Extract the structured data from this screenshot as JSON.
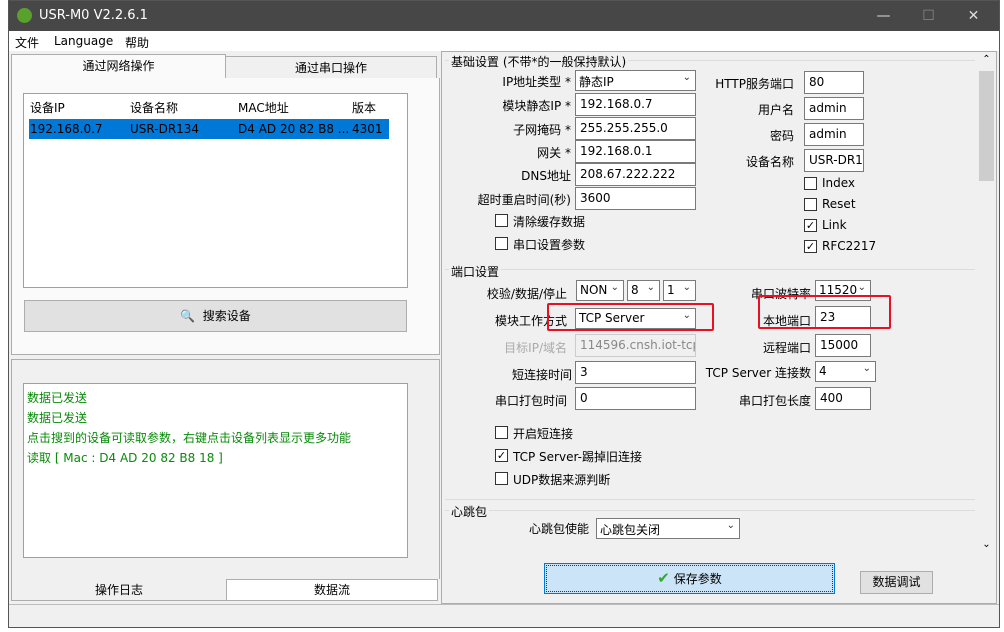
{
  "window": {
    "title": "USR-M0 V2.2.6.1",
    "minimize": "—",
    "maximize": "☐",
    "close": "✕"
  },
  "menu": [
    "文件",
    "Language",
    "帮助"
  ],
  "left": {
    "tabs": [
      "通过网络操作",
      "通过串口操作"
    ],
    "table": {
      "headers": [
        "设备IP",
        "设备名称",
        "MAC地址",
        "版本"
      ],
      "rows": [
        [
          "192.168.0.7",
          "USR-DR134",
          "D4 AD 20 82 B8 ...",
          "4301"
        ]
      ]
    },
    "search_button": "搜索设备",
    "log": [
      "数据已发送",
      "数据已发送",
      "点击搜到的设备可读取参数，右键点击设备列表显示更多功能",
      "读取 [ Mac : D4 AD 20 82 B8 18 ]"
    ],
    "bottom_tabs": [
      "操作日志",
      "数据流"
    ]
  },
  "basic": {
    "legend": "基础设置 (不带*的一般保持默认)",
    "ip_type": {
      "label": "IP地址类型 *",
      "value": "静态IP"
    },
    "static_ip": {
      "label": "模块静态IP *",
      "value": "192.168.0.7"
    },
    "subnet": {
      "label": "子网掩码 *",
      "value": "255.255.255.0"
    },
    "gateway": {
      "label": "网关 *",
      "value": "192.168.0.1"
    },
    "dns": {
      "label": "DNS地址",
      "value": "208.67.222.222"
    },
    "timeout": {
      "label": "超时重启时间(秒)",
      "value": "3600"
    },
    "clear_cache": {
      "label": "清除缓存数据",
      "checked": false
    },
    "serial_params": {
      "label": "串口设置参数",
      "checked": false
    },
    "http_port": {
      "label": "HTTP服务端口",
      "value": "80"
    },
    "username": {
      "label": "用户名",
      "value": "admin"
    },
    "password": {
      "label": "密码",
      "value": "admin"
    },
    "device_name": {
      "label": "设备名称",
      "value": "USR-DR1"
    },
    "index": {
      "label": "Index",
      "checked": false
    },
    "reset": {
      "label": "Reset",
      "checked": false
    },
    "link": {
      "label": "Link",
      "checked": true
    },
    "rfc2217": {
      "label": "RFC2217",
      "checked": true
    }
  },
  "port": {
    "legend": "端口设置",
    "parity": {
      "label": "校验/数据/停止",
      "parity": "NON",
      "data": "8",
      "stop": "1"
    },
    "baud": {
      "label": "串口波特率",
      "value": "11520"
    },
    "mode": {
      "label": "模块工作方式",
      "value": "TCP Server"
    },
    "local_port": {
      "label": "本地端口",
      "value": "23"
    },
    "target": {
      "label": "目标IP/域名",
      "value": "114596.cnsh.iot-tcp."
    },
    "remote_port": {
      "label": "远程端口",
      "value": "15000"
    },
    "short_time": {
      "label": "短连接时间",
      "value": "3"
    },
    "conn_count": {
      "label": "TCP Server 连接数",
      "value": "4"
    },
    "pack_time": {
      "label": "串口打包时间",
      "value": "0"
    },
    "pack_len": {
      "label": "串口打包长度",
      "value": "400"
    },
    "short_conn": {
      "label": "开启短连接",
      "checked": false
    },
    "kick_old": {
      "label": "TCP Server-踢掉旧连接",
      "checked": true
    },
    "udp_src": {
      "label": "UDP数据来源判断",
      "checked": false
    }
  },
  "heartbeat": {
    "legend": "心跳包",
    "enable": {
      "label": "心跳包使能",
      "value": "心跳包关闭"
    }
  },
  "buttons": {
    "save": "保存参数",
    "debug": "数据调试"
  },
  "colors": {
    "selection": "#0078d7",
    "log_text": "#0a8a0a",
    "highlight": "#e81123"
  }
}
